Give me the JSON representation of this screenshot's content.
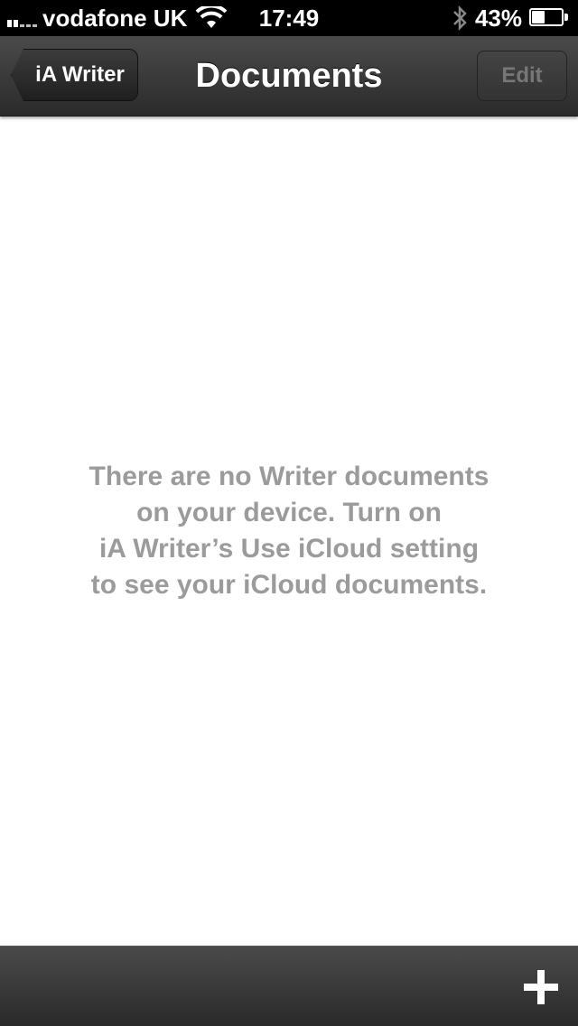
{
  "status_bar": {
    "carrier": "vodafone UK",
    "time": "17:49",
    "battery_percent": "43%",
    "battery_level": 0.43,
    "icons": [
      "signal-icon",
      "wifi-icon",
      "bluetooth-icon",
      "battery-icon"
    ]
  },
  "nav_bar": {
    "back_label": "iA Writer",
    "title": "Documents",
    "edit_label": "Edit"
  },
  "empty_state": {
    "lines": [
      "There are no Writer documents",
      "on your device. Turn on",
      "iA Writer’s Use iCloud setting",
      "to see your iCloud documents."
    ]
  },
  "toolbar": {
    "add_icon": "plus-icon"
  },
  "colors": {
    "nav_background": "#2f2f2f",
    "message_text": "#9b9b9b",
    "edit_disabled_text": "#777777"
  }
}
